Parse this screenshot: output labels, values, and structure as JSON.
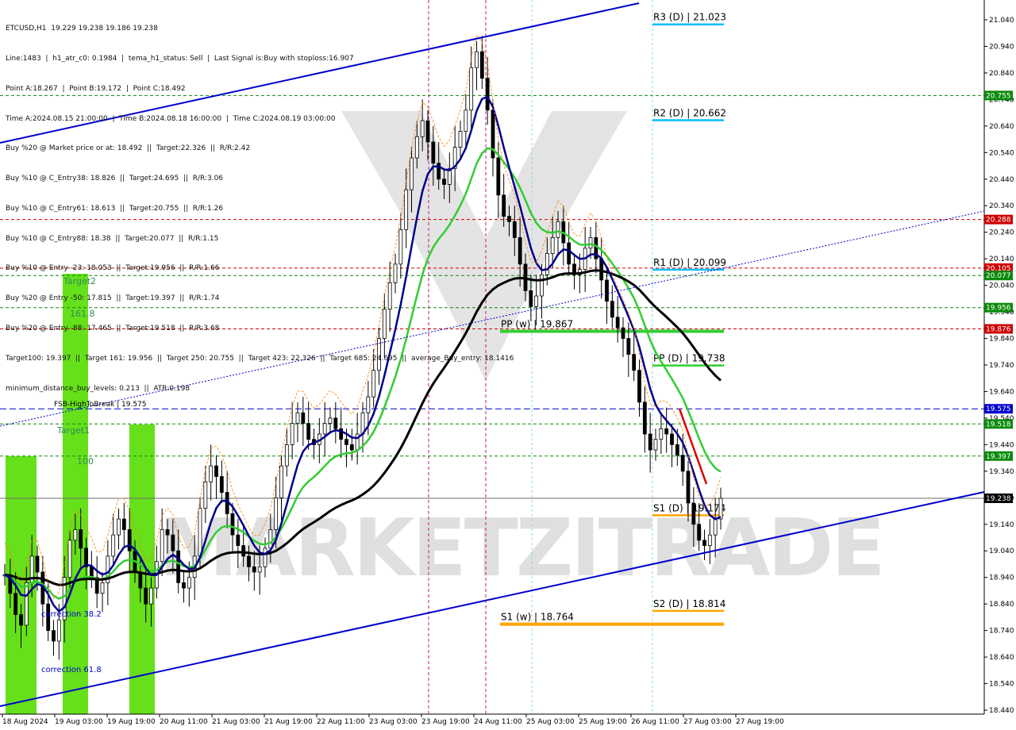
{
  "symbol_header": "ETCUSD,H1  19.229 19.238 19.186 19.238",
  "info_lines": [
    "Line:1483  |  h1_atr_c0: 0.1984  |  tema_h1_status: Sell  |  Last Signal is:Buy with stoploss:16.907",
    "Point A:18.267  |  Point B:19.172  |  Point C:18.492",
    "Time A:2024.08.15 21:00:00  |  Time B:2024.08.18 16:00:00  |  Time C:2024.08.19 03:00:00",
    "Buy %20 @ Market price or at: 18.492  ||  Target:22.326  ||  R/R:2.42",
    "Buy %10 @ C_Entry38: 18.826  ||  Target:24.695  ||  R/R:3.06",
    "Buy %10 @ C_Entry61: 18.613  ||  Target:20.755  ||  R/R:1.26",
    "Buy %10 @ C_Entry88: 18.38  ||  Target:20.077  ||  R/R:1.15",
    "Buy %10 @ Entry -23: 18.053  ||  Target:19.956  ||  R/R:1.66",
    "Buy %20 @ Entry -50: 17.815  ||  Target:19.397  ||  R/R:1.74",
    "Buy %20 @ Entry -88: 17.465  ||  Target:19.518  ||  R/R:3.68",
    "Target100: 19.397  ||  Target 161: 19.956  ||  Target 250: 20.755  ||  Target 423: 22.326  ||  Target 685: 24.695  ||  average_Buy_entry: 18.1416",
    "minimum_distance_buy_levels: 0.213  ||  ATR:0.198"
  ],
  "colors": {
    "bullish": "#0a0a0a",
    "tema": "#00008b",
    "ma_green": "#32cd32",
    "ma_black": "#000000",
    "trendline": "#0000cd",
    "target_box": "#66e01a",
    "red_level": "#cc0000",
    "green_level": "#0a8a0a",
    "pivot_blue": "#00bfff",
    "pivot_green": "#32cd32",
    "pivot_orange": "#ffa500",
    "current_price": "#6e6e6e"
  },
  "watermark": "MARKETZITRADE",
  "price_axis": {
    "ticks": [
      "21.040",
      "20.940",
      "20.840",
      "20.740",
      "20.640",
      "20.540",
      "20.440",
      "20.340",
      "20.240",
      "20.140",
      "20.040",
      "19.940",
      "19.840",
      "19.740",
      "19.640",
      "19.540",
      "19.440",
      "19.340",
      "19.240",
      "19.140",
      "19.040",
      "18.940",
      "18.840",
      "18.740",
      "18.640",
      "18.540",
      "18.440"
    ],
    "tags": [
      {
        "label": "20.755",
        "bg": "#0a8a0a",
        "value": 20.755
      },
      {
        "label": "20.288",
        "bg": "#cc0000",
        "value": 20.288
      },
      {
        "label": "20.105",
        "bg": "#cc0000",
        "value": 20.105
      },
      {
        "label": "20.077",
        "bg": "#0a8a0a",
        "value": 20.077
      },
      {
        "label": "19.956",
        "bg": "#0a8a0a",
        "value": 19.956
      },
      {
        "label": "19.876",
        "bg": "#cc0000",
        "value": 19.876
      },
      {
        "label": "19.575",
        "bg": "#0000cd",
        "value": 19.575
      },
      {
        "label": "19.518",
        "bg": "#0a8a0a",
        "value": 19.518
      },
      {
        "label": "19.397",
        "bg": "#0a8a0a",
        "value": 19.397
      },
      {
        "label": "19.238",
        "bg": "#000000",
        "value": 19.238
      }
    ]
  },
  "time_axis": [
    "18 Aug 2024",
    "19 Aug 03:00",
    "19 Aug 19:00",
    "20 Aug 11:00",
    "21 Aug 03:00",
    "21 Aug 19:00",
    "22 Aug 11:00",
    "23 Aug 03:00",
    "23 Aug 19:00",
    "24 Aug 11:00",
    "25 Aug 03:00",
    "25 Aug 19:00",
    "26 Aug 11:00",
    "27 Aug 03:00",
    "27 Aug 19:00"
  ],
  "chart_data": {
    "type": "candlestick",
    "title": "ETCUSD,H1",
    "ylim": [
      18.44,
      21.08
    ],
    "approx_close_series": [
      18.95,
      18.88,
      18.8,
      18.76,
      18.92,
      19.02,
      18.96,
      18.84,
      18.74,
      18.7,
      18.78,
      18.94,
      19.08,
      19.12,
      19.05,
      18.98,
      18.94,
      18.88,
      18.92,
      19.02,
      19.1,
      19.16,
      19.12,
      19.04,
      18.96,
      18.9,
      18.84,
      18.9,
      19.0,
      19.12,
      19.1,
      19.04,
      18.92,
      18.9,
      18.94,
      19.02,
      19.2,
      19.3,
      19.36,
      19.32,
      19.26,
      19.18,
      19.1,
      19.06,
      19.02,
      18.98,
      18.96,
      18.98,
      19.05,
      19.12,
      19.24,
      19.36,
      19.44,
      19.52,
      19.56,
      19.52,
      19.46,
      19.44,
      19.48,
      19.52,
      19.54,
      19.5,
      19.46,
      19.44,
      19.42,
      19.48,
      19.56,
      19.62,
      19.72,
      19.84,
      19.95,
      20.05,
      20.12,
      20.25,
      20.4,
      20.52,
      20.6,
      20.66,
      20.58,
      20.5,
      20.44,
      20.42,
      20.48,
      20.56,
      20.62,
      20.7,
      20.86,
      20.92,
      20.82,
      20.7,
      20.52,
      20.38,
      20.3,
      20.28,
      20.22,
      20.12,
      20.02,
      19.96,
      20.0,
      20.08,
      20.16,
      20.22,
      20.28,
      20.2,
      20.12,
      20.08,
      20.1,
      20.18,
      20.22,
      20.14,
      20.06,
      19.98,
      19.92,
      19.88,
      19.84,
      19.78,
      19.72,
      19.6,
      19.48,
      19.42,
      19.46,
      19.5,
      19.48,
      19.44,
      19.4,
      19.34,
      19.22,
      19.14,
      19.08,
      19.06,
      19.1,
      19.16,
      19.238
    ],
    "levels": [
      {
        "label": "R3 (D) | 21.023",
        "value": 21.023,
        "color": "#00bfff"
      },
      {
        "label": "R2 (D) | 20.662",
        "value": 20.662,
        "color": "#00bfff"
      },
      {
        "label": "R1 (D) | 20.099",
        "value": 20.099,
        "color": "#00bfff"
      },
      {
        "label": "PP (w) | 19.867",
        "value": 19.867,
        "color": "#32cd32"
      },
      {
        "label": "PP (D) | 19.738",
        "value": 19.738,
        "color": "#32cd32"
      },
      {
        "label": "S1 (D) | 19.174",
        "value": 19.174,
        "color": "#ffa500"
      },
      {
        "label": "S2 (D) | 18.814",
        "value": 18.814,
        "color": "#ffa500"
      },
      {
        "label": "S1 (w) | 18.764",
        "value": 18.764,
        "color": "#ffa500"
      }
    ],
    "annotations": [
      "Target2",
      "161.8",
      "Target1",
      "100",
      "FSB-HighToBreak | 19.575",
      "correction 38.2",
      "correction 61.8"
    ]
  }
}
